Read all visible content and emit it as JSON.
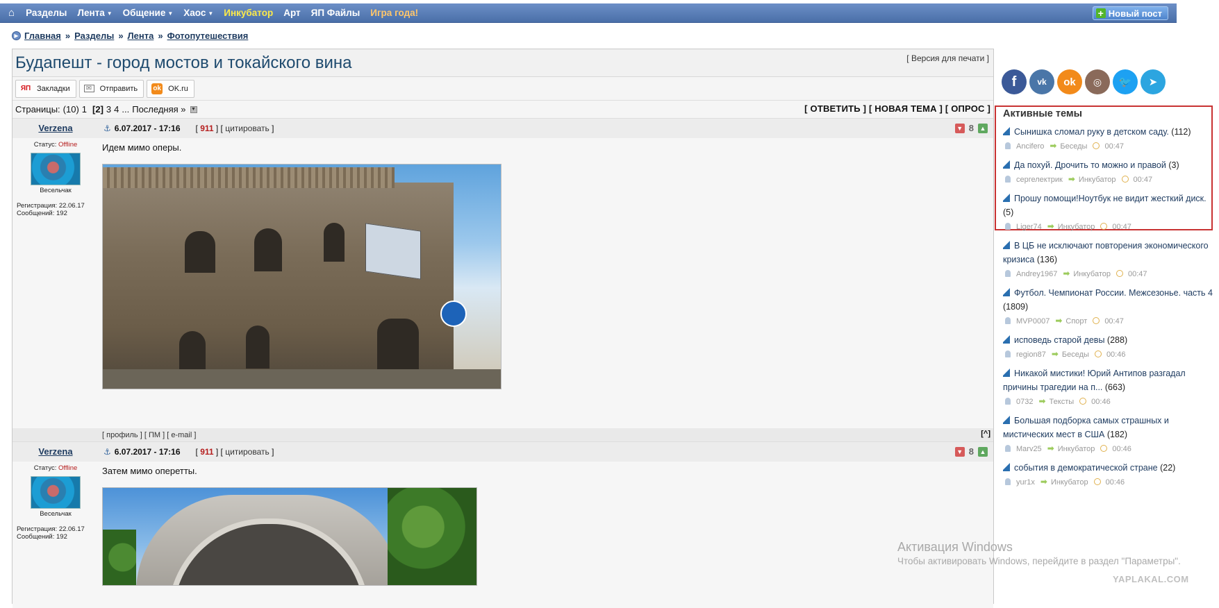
{
  "nav": {
    "home_icon": "⌂",
    "items": [
      {
        "label": "Разделы",
        "dropdown": false,
        "color": "white"
      },
      {
        "label": "Лента",
        "dropdown": true,
        "color": "white"
      },
      {
        "label": "Общение",
        "dropdown": true,
        "color": "white"
      },
      {
        "label": "Хаос",
        "dropdown": true,
        "color": "white"
      },
      {
        "label": "Инкубатор",
        "dropdown": false,
        "color": "yellow"
      },
      {
        "label": "Арт",
        "dropdown": false,
        "color": "white"
      },
      {
        "label": "ЯП Файлы",
        "dropdown": false,
        "color": "white"
      },
      {
        "label": "Игра года!",
        "dropdown": false,
        "color": "orange"
      }
    ],
    "new_post_label": "Новый пост"
  },
  "breadcrumb": [
    "Главная",
    "Разделы",
    "Лента",
    "Фотопутешествия"
  ],
  "topic": {
    "title": "Будапешт - город мостов и токайского вина",
    "print_link": "Версия для печати",
    "share": {
      "bookmarks": "Закладки",
      "send": "Отправить",
      "ok": "OK.ru"
    },
    "pages": {
      "label": "Страницы:",
      "total": "(10)",
      "list": [
        "1",
        "[2]",
        "3",
        "4"
      ],
      "ellipsis": "...",
      "last": "Последняя »"
    },
    "actions": "[ ОТВЕТИТЬ ] [ НОВАЯ ТЕМА ] [ ОПРОС ]"
  },
  "posts": [
    {
      "author": "Verzena",
      "status_label": "Статус:",
      "status_value": "Offline",
      "rank": "Весельчак",
      "reg": "Регистрация: 22.06.17",
      "msgs": "Сообщений: 192",
      "date": "6.07.2017 - 17:16",
      "num": "911",
      "quote": "цитировать",
      "score": "8",
      "text": "Идем мимо оперы.",
      "footer": {
        "profile": "профиль",
        "pm": "ПМ",
        "email": "e-mail",
        "top": "[^]"
      }
    },
    {
      "author": "Verzena",
      "status_label": "Статус:",
      "status_value": "Offline",
      "rank": "Весельчак",
      "reg": "Регистрация: 22.06.17",
      "msgs": "Сообщений: 192",
      "date": "6.07.2017 - 17:16",
      "num": "911",
      "quote": "цитировать",
      "score": "8",
      "text": "Затем мимо оперетты."
    }
  ],
  "social": [
    "f",
    "vk",
    "ok",
    "ig",
    "tw",
    "tg"
  ],
  "active_topics": {
    "title": "Активные темы",
    "items": [
      {
        "title": "Сынишка сломал руку в детском саду.",
        "count": "(112)",
        "user": "Ancifero",
        "section": "Беседы",
        "time": "00:47"
      },
      {
        "title": "Да похуй. Дрочить то можно и правой",
        "count": "(3)",
        "user": "сергелектрик",
        "section": "Инкубатор",
        "time": "00:47"
      },
      {
        "title": "Прошу помощи!Ноутбук не видит жесткий диск.",
        "count": "(5)",
        "user": "Liger74",
        "section": "Инкубатор",
        "time": "00:47"
      },
      {
        "title": "В ЦБ не исключают повторения экономического кризиса",
        "count": "(136)",
        "user": "Andrey1967",
        "section": "Инкубатор",
        "time": "00:47"
      },
      {
        "title": "Футбол. Чемпионат России. Межсезонье. часть 4",
        "count": "(1809)",
        "user": "MVP0007",
        "section": "Спорт",
        "time": "00:47"
      },
      {
        "title": "исповедь старой девы",
        "count": "(288)",
        "user": "region87",
        "section": "Беседы",
        "time": "00:46"
      },
      {
        "title": "Никакой мистики! Юрий Антипов разгадал причины трагедии на п...",
        "count": "(663)",
        "user": "0732",
        "section": "Тексты",
        "time": "00:46"
      },
      {
        "title": "Большая подборка самых страшных и мистических мест в США",
        "count": "(182)",
        "user": "Marv25",
        "section": "Инкубатор",
        "time": "00:46"
      },
      {
        "title": "события в демократической стране",
        "count": "(22)",
        "user": "yur1x",
        "section": "Инкубатор",
        "time": "00:46"
      }
    ]
  },
  "watermark": {
    "title": "Активация Windows",
    "subtitle": "Чтобы активировать Windows, перейдите в раздел \"Параметры\".",
    "site": "YAPLAKAL.COM"
  }
}
